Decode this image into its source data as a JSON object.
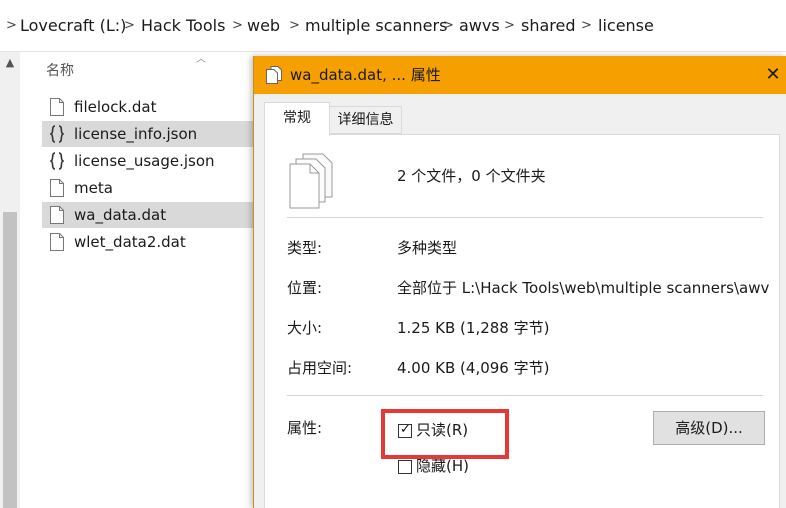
{
  "breadcrumb": {
    "items": [
      "Lovecraft (L:)",
      "Hack Tools",
      "web",
      "multiple scanners",
      "awvs",
      "shared",
      "license"
    ],
    "separator": ">"
  },
  "file_list": {
    "header": "名称",
    "files": [
      {
        "name": "filelock.dat",
        "icon": "file-icon",
        "selected": false
      },
      {
        "name": "license_info.json",
        "icon": "json-file-icon",
        "selected": true
      },
      {
        "name": "license_usage.json",
        "icon": "json-file-icon",
        "selected": false
      },
      {
        "name": "meta",
        "icon": "file-icon",
        "selected": false
      },
      {
        "name": "wa_data.dat",
        "icon": "file-icon",
        "selected": true
      },
      {
        "name": "wlet_data2.dat",
        "icon": "file-icon",
        "selected": false
      }
    ]
  },
  "dialog": {
    "title": "wa_data.dat, ... 属性",
    "close_glyph": "✕",
    "tabs": [
      {
        "label": "常规",
        "active": true
      },
      {
        "label": "详细信息",
        "active": false
      }
    ],
    "summary": "2 个文件，0 个文件夹",
    "rows": [
      {
        "label": "类型:",
        "value": "多种类型"
      },
      {
        "label": "位置:",
        "value": "全部位于 L:\\Hack Tools\\web\\multiple scanners\\awvs"
      },
      {
        "label": "大小:",
        "value": "1.25 KB (1,288 字节)"
      },
      {
        "label": "占用空间:",
        "value": "4.00 KB (4,096 字节)"
      }
    ],
    "attributes_label": "属性:",
    "readonly": {
      "label": "只读(R)",
      "checked": true
    },
    "hidden": {
      "label": "隐藏(H)",
      "checked": false
    },
    "advanced_button": "高级(D)...",
    "title_bar_color": "#f5a000",
    "highlight_color": "#e53935"
  }
}
